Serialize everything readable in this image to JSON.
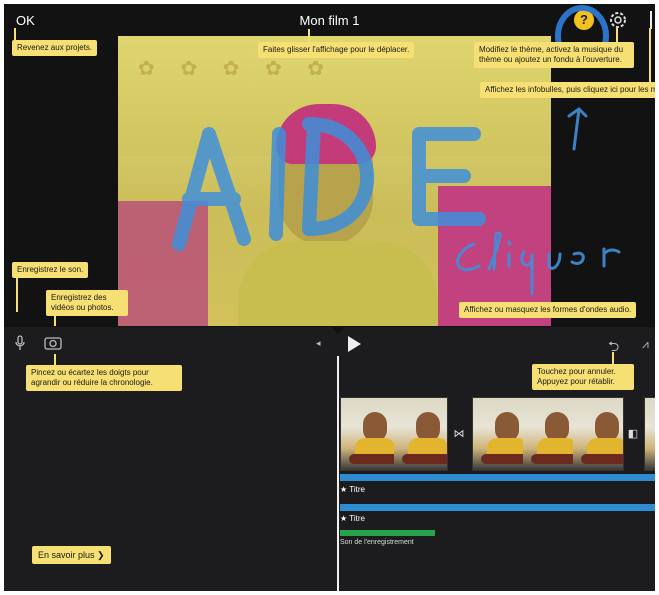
{
  "app": {
    "title": "Mon film 1",
    "ok_label": "OK",
    "help_label": "?",
    "accent": "#f4c21f",
    "tooltip_color": "#f6df73",
    "track_color": "#2e8dd1",
    "green_track_color": "#27a34b"
  },
  "annotations": {
    "word": "AIDE",
    "word2": "cliquer",
    "color": "#3f8fd9"
  },
  "tips": {
    "back": "Revenez aux projets.",
    "drag": "Faites glisser l'affichage pour le déplacer.",
    "theme": "Modifiez le thème, activez la musique du thème ou ajoutez un fondu à l'ouverture.",
    "hide_tips": "Affichez les infobulles, puis cliquez ici pour les masquer.",
    "record_audio": "Enregistrez le son.",
    "record_video": "Enregistrez des vidéos ou photos.",
    "waveforms": "Affichez ou masquez les formes d'ondes audio.",
    "pinch": "Pincez ou écartez les doigts pour agrandir ou réduire la chronologie.",
    "undo": "Touchez pour annuler. Appuyez pour rétablir.",
    "learn_more": "En savoir plus"
  },
  "timeline": {
    "clips": [
      {
        "name": "clip-1"
      },
      {
        "name": "clip-2"
      },
      {
        "name": "clip-3"
      }
    ],
    "track1_label": "Titre",
    "track2_label": "Titre",
    "green_label": "Son de l'enregistrement"
  },
  "icons": {
    "mic": "microphone-icon",
    "camera": "camera-icon",
    "play": "play-icon",
    "undo": "undo-icon",
    "wave": "waveform-icon",
    "gear": "gear-icon"
  }
}
